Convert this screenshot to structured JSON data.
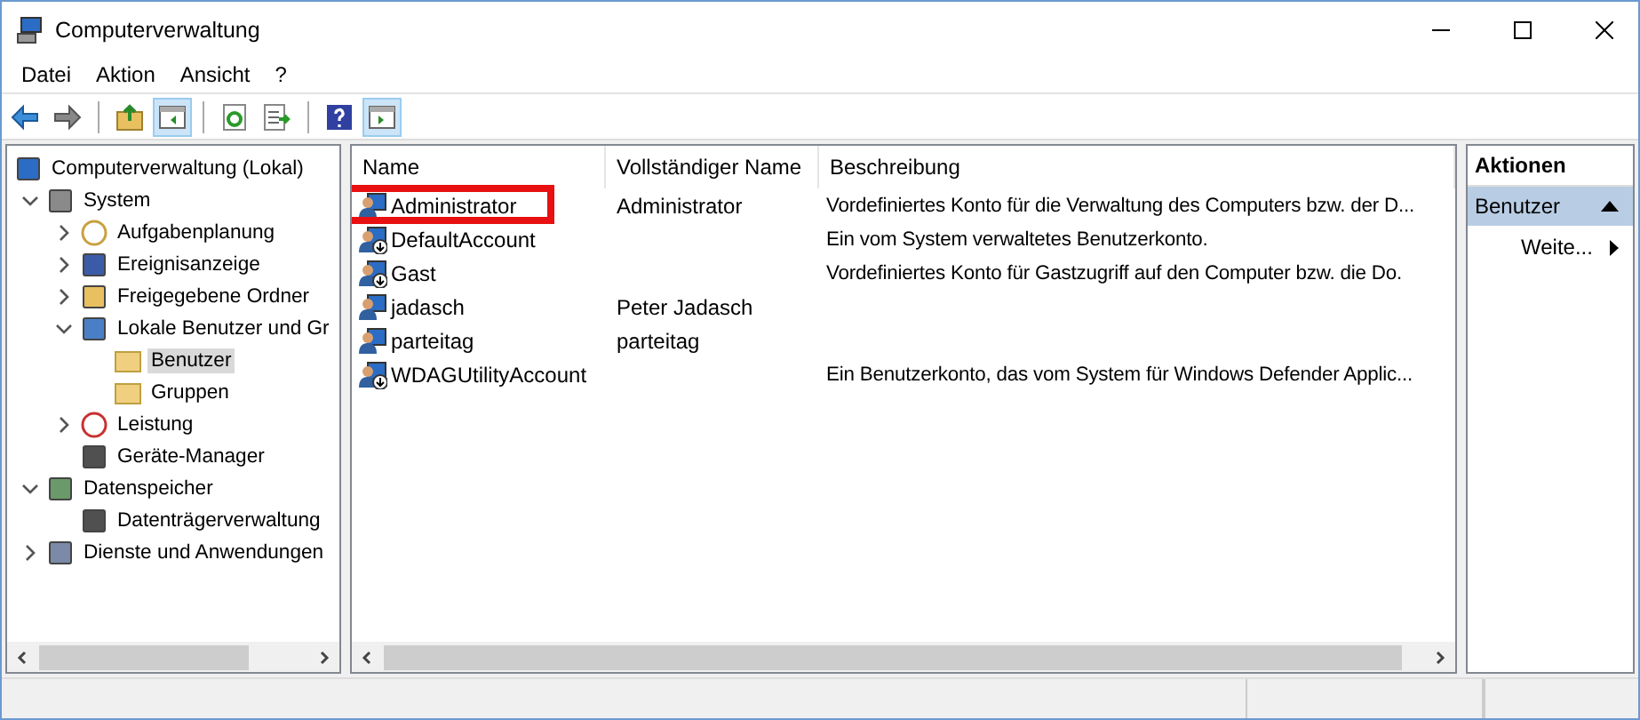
{
  "window": {
    "title": "Computerverwaltung"
  },
  "menu": [
    {
      "label": "Datei"
    },
    {
      "label": "Aktion"
    },
    {
      "label": "Ansicht"
    },
    {
      "label": "?"
    }
  ],
  "toolbar": [
    {
      "kind": "back",
      "pressed": false
    },
    {
      "kind": "forward",
      "pressed": false
    },
    {
      "kind": "separator"
    },
    {
      "kind": "up",
      "pressed": false
    },
    {
      "kind": "tree-toggle",
      "pressed": true
    },
    {
      "kind": "separator"
    },
    {
      "kind": "refresh",
      "pressed": false
    },
    {
      "kind": "export",
      "pressed": false
    },
    {
      "kind": "separator"
    },
    {
      "kind": "help",
      "pressed": false
    },
    {
      "kind": "action-toggle",
      "pressed": true
    }
  ],
  "tree": {
    "label": "Computerverwaltung (Lokal)",
    "kind": "computer",
    "selected": false,
    "children": [
      {
        "label": "System",
        "kind": "tools",
        "expanded": true,
        "selected": false,
        "children": [
          {
            "label": "Aufgabenplanung",
            "kind": "clock",
            "expanded": false,
            "selected": false
          },
          {
            "label": "Ereignisanzeige",
            "kind": "log",
            "expanded": false,
            "selected": false
          },
          {
            "label": "Freigegebene Ordner",
            "kind": "share",
            "expanded": false,
            "selected": false
          },
          {
            "label": "Lokale Benutzer und Gr",
            "kind": "users",
            "expanded": true,
            "selected": false,
            "children": [
              {
                "label": "Benutzer",
                "kind": "folder",
                "selected": true
              },
              {
                "label": "Gruppen",
                "kind": "folder",
                "selected": false
              }
            ]
          },
          {
            "label": "Leistung",
            "kind": "gauge",
            "expanded": false,
            "selected": false
          },
          {
            "label": "Geräte-Manager",
            "kind": "device",
            "selected": false
          }
        ]
      },
      {
        "label": "Datenspeicher",
        "kind": "storage",
        "expanded": true,
        "selected": false,
        "children": [
          {
            "label": "Datenträgerverwaltung",
            "kind": "disk",
            "selected": false
          }
        ]
      },
      {
        "label": "Dienste und Anwendungen",
        "kind": "services",
        "expanded": false,
        "selected": false
      }
    ]
  },
  "table": {
    "columns": [
      "Name",
      "Vollständiger Name",
      "Beschreibung"
    ],
    "rows": [
      {
        "name": "Administrator",
        "full_name": "Administrator",
        "description": "Vordefiniertes Konto für die Verwaltung des Computers bzw. der D...",
        "disabled": false,
        "highlighted": true
      },
      {
        "name": "DefaultAccount",
        "description": "Ein vom System verwaltetes Benutzerkonto.",
        "disabled": true,
        "highlighted": false
      },
      {
        "name": "Gast",
        "description": "Vordefiniertes Konto für Gastzugriff auf den Computer bzw. die Do.",
        "disabled": true,
        "highlighted": false
      },
      {
        "name": "jadasch",
        "full_name": "Peter Jadasch",
        "disabled": false,
        "highlighted": false
      },
      {
        "name": "parteitag",
        "full_name": "parteitag",
        "disabled": false,
        "highlighted": false
      },
      {
        "name": "WDAGUtilityAccount",
        "description": "Ein Benutzerkonto, das vom System für Windows Defender Applic...",
        "disabled": true,
        "highlighted": false
      }
    ]
  },
  "actions": {
    "title": "Aktionen",
    "section": {
      "label": "Benutzer",
      "expanded": true
    },
    "items": [
      {
        "label": "Weite..."
      }
    ]
  }
}
